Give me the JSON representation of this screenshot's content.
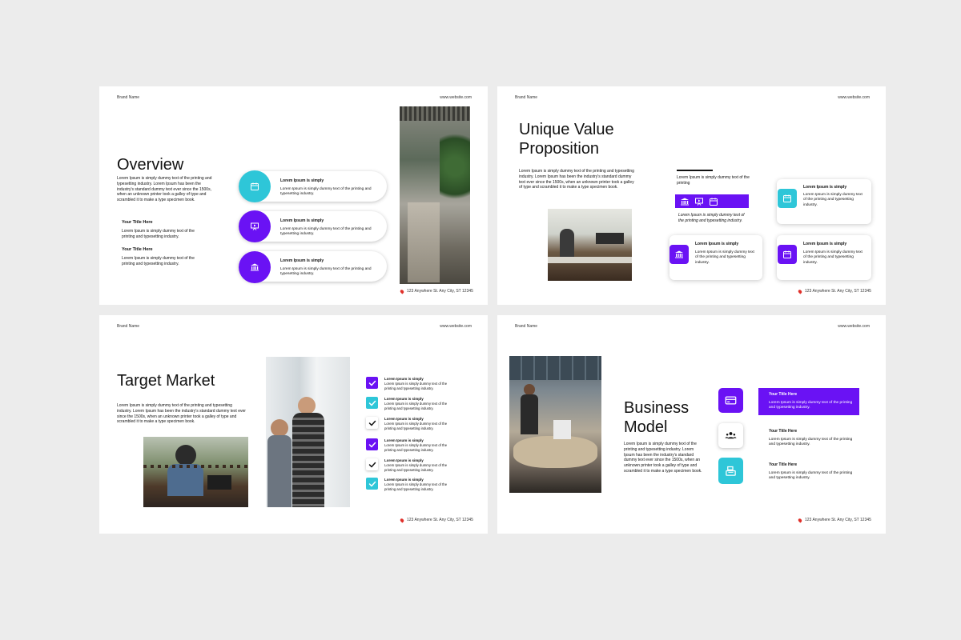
{
  "brand": "Brand Name",
  "website": "www.website.com",
  "address": "123 Anywhere St. Any City, ST 12345",
  "colors": {
    "purple": "#6a12f4",
    "teal": "#2ec6d8"
  },
  "lorem_long": "Lorem Ipsum is simply dummy text of the printing and typesetting industry. Lorem Ipsum has been the industry's standard dummy text ever since the 1500s, when an unknown printer took a galley of type and scrambled it to make a type specimen book.",
  "overview": {
    "title": "Overview",
    "items": [
      {
        "title": "Your Title Here",
        "text": "Lorem Ipsum is simply dummy text of the printing and typesetting industry."
      },
      {
        "title": "Your Title Here",
        "text": "Lorem Ipsum is simply dummy text of the printing and typesetting industry."
      }
    ],
    "pills": [
      {
        "icon": "calendar-icon",
        "title": "Lorem Ipsum is simply",
        "text": "Lorem Ipsum is simply dummy text of the printing and typesetting industry."
      },
      {
        "icon": "presentation-icon",
        "title": "Lorem Ipsum is simply",
        "text": "Lorem Ipsum is simply dummy text of the printing and typesetting industry."
      },
      {
        "icon": "bank-icon",
        "title": "Lorem Ipsum is simply",
        "text": "Lorem Ipsum is simply dummy text of the printing and typesetting industry."
      }
    ]
  },
  "uvp": {
    "title_line1": "Unique Value",
    "title_line2": "Proposition",
    "body": "Lorem Ipsum is simply dummy text of the printing and typesetting industry. Lorem Ipsum has been the industry's standard dummy text ever since the 1500s, when an unknown printer took a galley of type and scrambled it to make a type specimen book.",
    "mid_title": "Lorem Ipsum is simply dummy text of the printing",
    "mid_caption": "Lorem Ipsum is simply dummy text of the printing and typesetting industry.",
    "cards": [
      {
        "icon": "calendar-icon",
        "title": "Lorem Ipsum is simply",
        "text": "Lorem Ipsum is simply dummy text of the printing and typesetting industry."
      },
      {
        "icon": "bank-icon",
        "title": "Lorem Ipsum is simply",
        "text": "Lorem Ipsum is simply dummy text of the printing and typesetting industry."
      },
      {
        "icon": "calendar-icon",
        "title": "Lorem Ipsum is simply",
        "text": "Lorem Ipsum is simply dummy text of the printing and typesetting industry."
      }
    ]
  },
  "target": {
    "title": "Target Market",
    "body": "Lorem Ipsum is simply dummy text of the printing and typesetting industry. Lorem Ipsum has been the industry's standard dummy text ever since the 1500s, when an unknown printer took a galley of type and scrambled it to make a type specimen book.",
    "checks": [
      {
        "style": "purple",
        "title": "Lorem Ipsum is simply",
        "text": "Lorem Ipsum is simply dummy text of the printing and typesetting industry."
      },
      {
        "style": "teal",
        "title": "Lorem Ipsum is simply",
        "text": "Lorem Ipsum is simply dummy text of the printing and typesetting industry."
      },
      {
        "style": "white",
        "title": "Lorem Ipsum is simply",
        "text": "Lorem Ipsum is simply dummy text of the printing and typesetting industry."
      },
      {
        "style": "purple",
        "title": "Lorem Ipsum is simply",
        "text": "Lorem Ipsum is simply dummy text of the printing and typesetting industry."
      },
      {
        "style": "white",
        "title": "Lorem Ipsum is simply",
        "text": "Lorem Ipsum is simply dummy text of the printing and typesetting industry."
      },
      {
        "style": "teal",
        "title": "Lorem Ipsum is simply",
        "text": "Lorem Ipsum is simply dummy text of the printing and typesetting industry."
      }
    ]
  },
  "business": {
    "title_line1": "Business",
    "title_line2": "Model",
    "body": "Lorem Ipsum is simply dummy text of the printing and typesetting industry. Lorem Ipsum has been the industry's standard dummy text ever since the 1500s, when an unknown printer took a galley of type and scrambled it to make a type specimen book.",
    "items": [
      {
        "icon": "credit-card-icon",
        "title": "Your Title Here",
        "text": "Lorem Ipsum is simply dummy text of the printing and typesetting industry."
      },
      {
        "icon": "team-icon",
        "title": "Your Title Here",
        "text": "Lorem Ipsum is simply dummy text of the printing and typesetting industry."
      },
      {
        "icon": "cash-register-icon",
        "title": "Your Title Here",
        "text": "Lorem Ipsum is simply dummy text of the printing and typesetting industry."
      }
    ]
  }
}
